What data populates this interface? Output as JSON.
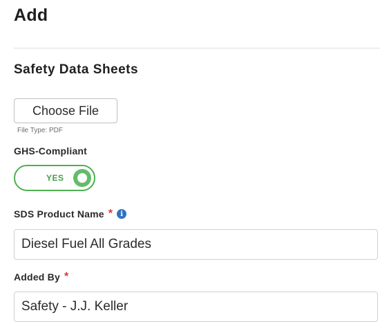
{
  "page": {
    "title": "Add"
  },
  "section": {
    "title": "Safety Data Sheets"
  },
  "file_upload": {
    "button_label": "Choose File",
    "file_type_hint": "File Type: PDF"
  },
  "ghs": {
    "label": "GHS-Compliant",
    "toggle_text": "YES",
    "toggle_on": true,
    "accent_color": "#4caf50"
  },
  "product_name": {
    "label": "SDS Product Name",
    "required_mark": "*",
    "info_icon": "info-icon",
    "value": "Diesel Fuel All Grades"
  },
  "added_by": {
    "label": "Added By",
    "required_mark": "*",
    "value": "Safety - J.J. Keller"
  },
  "colors": {
    "required": "#d9363e",
    "info": "#2f74c0"
  }
}
